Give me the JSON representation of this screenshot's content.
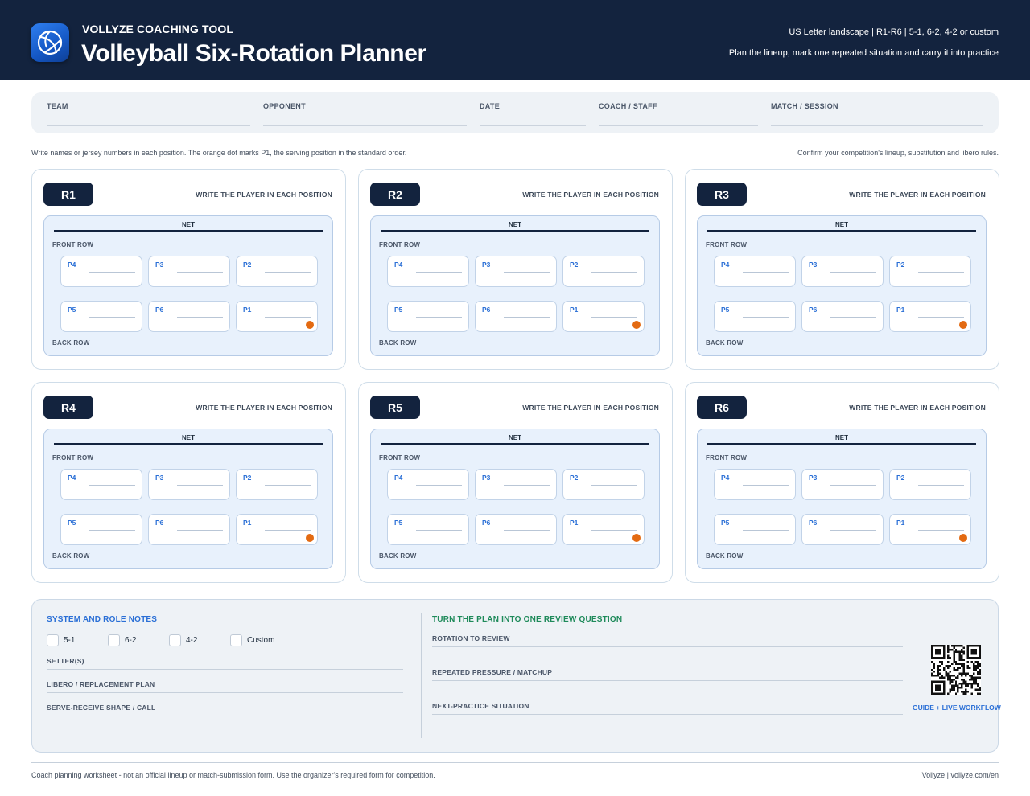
{
  "header": {
    "eyebrow": "VOLLYZE COACHING TOOL",
    "title": "Volleyball Six-Rotation Planner",
    "meta": "US Letter landscape | R1-R6 | 5-1, 6-2, 4-2 or custom",
    "subtitle": "Plan the lineup, mark one repeated situation and carry it into practice",
    "logo_icon": "volleyball-icon",
    "bg_color": "#13233e"
  },
  "info_fields": [
    {
      "label": "TEAM"
    },
    {
      "label": "OPPONENT"
    },
    {
      "label": "DATE"
    },
    {
      "label": "COACH / STAFF"
    },
    {
      "label": "MATCH / SESSION"
    }
  ],
  "instructions": {
    "left": "Write names or jersey numbers in each position. The orange dot marks P1, the serving position in the standard order.",
    "right": "Confirm your competition's lineup, substitution and libero rules."
  },
  "court_labels": {
    "hint": "WRITE THE PLAYER IN EACH POSITION",
    "net": "NET",
    "front_row": "FRONT ROW",
    "back_row": "BACK ROW",
    "front_positions": [
      "P4",
      "P3",
      "P2"
    ],
    "back_positions": [
      "P5",
      "P6",
      "P1"
    ]
  },
  "rotations": [
    {
      "label": "R1"
    },
    {
      "label": "R2"
    },
    {
      "label": "R3"
    },
    {
      "label": "R4"
    },
    {
      "label": "R5"
    },
    {
      "label": "R6"
    }
  ],
  "notes": {
    "title": "SYSTEM AND ROLE NOTES",
    "systems": [
      "5-1",
      "6-2",
      "4-2",
      "Custom"
    ],
    "fields": [
      "SETTER(S)",
      "LIBERO / REPLACEMENT PLAN",
      "SERVE-RECEIVE SHAPE / CALL"
    ]
  },
  "review": {
    "title": "TURN THE PLAN INTO ONE REVIEW QUESTION",
    "fields": [
      "ROTATION TO REVIEW",
      "REPEATED PRESSURE / MATCHUP",
      "NEXT-PRACTICE SITUATION"
    ],
    "qr_caption": "GUIDE + LIVE WORKFLOW"
  },
  "footer": {
    "left": "Coach planning worksheet - not an official lineup or match-submission form. Use the organizer's required form for competition.",
    "right": "Vollyze | vollyze.com/en"
  },
  "colors": {
    "navy": "#13233e",
    "accent_blue": "#2a6fd6",
    "accent_green": "#1e8a5a",
    "serve_dot": "#e36a12"
  }
}
